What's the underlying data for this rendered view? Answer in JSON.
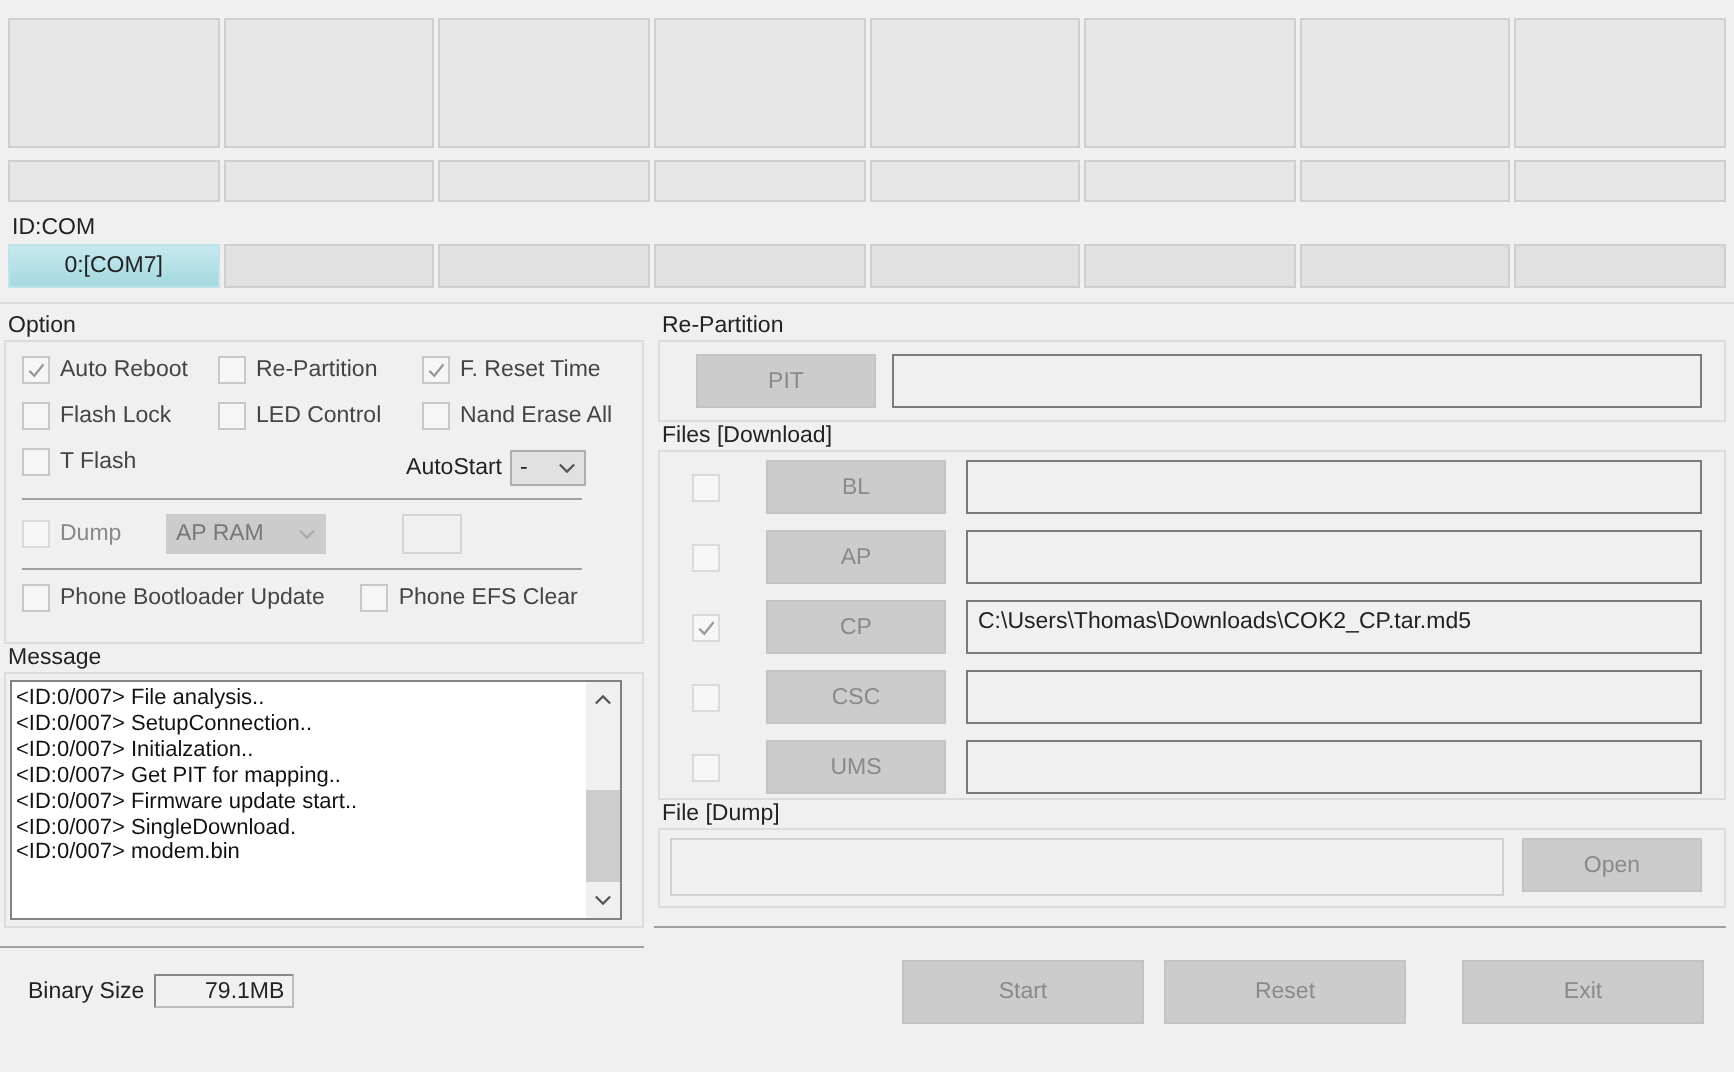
{
  "ports": [
    {
      "label": "0:[COM7]",
      "selected": true
    },
    {
      "selected": false
    },
    {
      "selected": false
    },
    {
      "selected": false
    },
    {
      "selected": false
    },
    {
      "selected": false
    },
    {
      "selected": false
    },
    {
      "selected": false
    }
  ],
  "id_com_label": "ID:COM",
  "option": {
    "title": "Option",
    "items": [
      {
        "label": "Auto Reboot",
        "checked": true
      },
      {
        "label": "Re-Partition",
        "checked": false
      },
      {
        "label": "F. Reset Time",
        "checked": true
      },
      {
        "label": "Flash Lock",
        "checked": false
      },
      {
        "label": "LED Control",
        "checked": false
      },
      {
        "label": "Nand Erase All",
        "checked": false
      },
      {
        "label": "T Flash",
        "checked": false
      }
    ],
    "autostart": {
      "label": "AutoStart",
      "value": "-"
    },
    "dump": {
      "label": "Dump",
      "checked": false,
      "disabled": true,
      "select": "AP RAM"
    },
    "extra": [
      {
        "label": "Phone Bootloader Update",
        "checked": false
      },
      {
        "label": "Phone EFS Clear",
        "checked": false
      }
    ]
  },
  "message": {
    "title": "Message",
    "lines": [
      "<ID:0/007> File analysis..",
      "<ID:0/007> SetupConnection..",
      "<ID:0/007> Initialzation..",
      "<ID:0/007> Get PIT for mapping..",
      "<ID:0/007> Firmware update start..",
      "<ID:0/007> SingleDownload.",
      "<ID:0/007> modem.bin"
    ]
  },
  "binary_size": {
    "label": "Binary Size",
    "value": "79.1MB"
  },
  "repartition": {
    "title": "Re-Partition",
    "button": {
      "label": "PIT",
      "disabled": true
    }
  },
  "files": {
    "title": "Files [Download]",
    "rows": [
      {
        "label": "BL",
        "checked": false,
        "disabled": true
      },
      {
        "label": "AP",
        "checked": false,
        "disabled": true
      },
      {
        "label": "CP",
        "checked": true,
        "disabled": true,
        "path": "C:\\Users\\Thomas\\Downloads\\COK2_CP.tar.md5"
      },
      {
        "label": "CSC",
        "checked": false,
        "disabled": true
      },
      {
        "label": "UMS",
        "checked": false,
        "disabled": true
      }
    ]
  },
  "dump_file": {
    "title": "File [Dump]",
    "button": {
      "label": "Open",
      "disabled": true
    }
  },
  "actions": [
    {
      "label": "Start",
      "disabled": true
    },
    {
      "label": "Reset",
      "disabled": true
    },
    {
      "label": "Exit",
      "disabled": true
    }
  ]
}
